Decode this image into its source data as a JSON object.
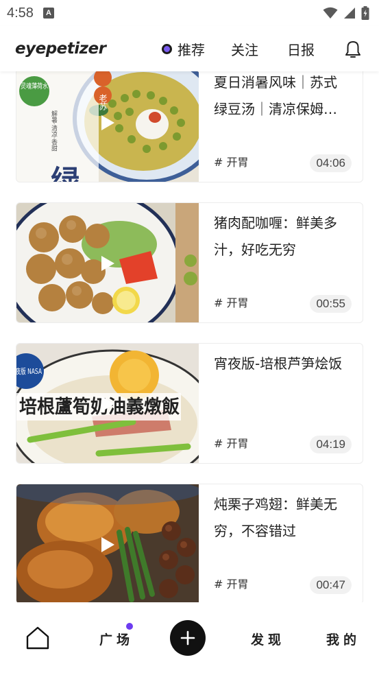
{
  "status_bar": {
    "time": "4:58",
    "notification_badge": "A"
  },
  "header": {
    "logo": "eyepetizer",
    "tabs": [
      {
        "label": "推荐",
        "active": true
      },
      {
        "label": "关注",
        "active": false
      },
      {
        "label": "日报",
        "active": false
      }
    ],
    "accent_color": "#7b5cf0"
  },
  "feed": {
    "items": [
      {
        "title": "夏日消暑风味｜苏式绿豆汤｜清凉保姆…",
        "tag": "# 开胃",
        "duration": "04:06",
        "thumb_text": {
          "corner": "灵魂薄荷水",
          "main": "绿豆汤",
          "badge": "老苏",
          "side": "解暑·清凉·香甜"
        }
      },
      {
        "title": "猪肉配咖喱：鲜美多汁，好吃无穷",
        "tag": "# 开胃",
        "duration": "00:55"
      },
      {
        "title": "宵夜版-培根芦笋烩饭",
        "tag": "# 开胃",
        "duration": "04:19",
        "thumb_text": {
          "badge": "宵夜版 NASA",
          "banner": "培根蘆筍奶油義燉飯"
        }
      },
      {
        "title": "炖栗子鸡翅：鲜美无穷，不容错过",
        "tag": "# 开胃",
        "duration": "00:47"
      }
    ]
  },
  "bottom_nav": {
    "home_icon": "home-icon",
    "square_label": "广场",
    "add_icon": "plus-icon",
    "discover_label": "发现",
    "me_label": "我的",
    "dot_color": "#6d3cf0"
  }
}
